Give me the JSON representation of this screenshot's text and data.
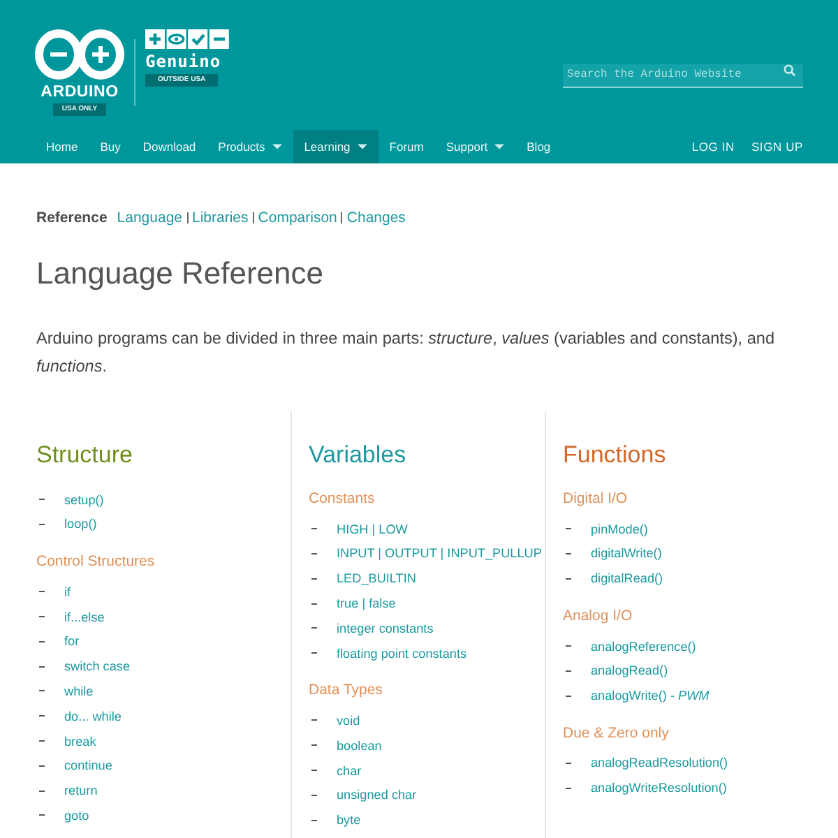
{
  "header": {
    "logo": {
      "wordmark": "ARDUINO",
      "badge": "USA ONLY"
    },
    "genuino": {
      "wordmark": "Genuino",
      "badge": "OUTSIDE USA"
    },
    "search": {
      "placeholder": "Search the Arduino Website"
    }
  },
  "nav": {
    "items": [
      {
        "label": "Home",
        "selected": false,
        "has_menu": false
      },
      {
        "label": "Buy",
        "selected": false,
        "has_menu": false
      },
      {
        "label": "Download",
        "selected": false,
        "has_menu": false
      },
      {
        "label": "Products",
        "selected": false,
        "has_menu": true
      },
      {
        "label": "Learning",
        "selected": true,
        "has_menu": true
      },
      {
        "label": "Forum",
        "selected": false,
        "has_menu": false
      },
      {
        "label": "Support",
        "selected": false,
        "has_menu": true
      },
      {
        "label": "Blog",
        "selected": false,
        "has_menu": false
      }
    ],
    "account": [
      "LOG IN",
      "SIGN UP"
    ]
  },
  "breadcrumb": {
    "current": "Reference",
    "links": [
      "Language",
      "Libraries",
      "Comparison",
      "Changes"
    ]
  },
  "title": "Language Reference",
  "intro": "Arduino programs can be divided in three main parts: *structure*, *values* (variables and constants), and *functions*.",
  "columns": [
    {
      "title": "Structure",
      "color": "#6f8f1f",
      "groups": [
        {
          "items": [
            "setup()",
            "loop()"
          ]
        },
        {
          "heading": "Control Structures",
          "items": [
            "if",
            "if...else",
            "for",
            "switch case",
            "while",
            "do... while",
            "break",
            "continue",
            "return",
            "goto"
          ]
        }
      ]
    },
    {
      "title": "Variables",
      "color": "#1e9aa0",
      "groups": [
        {
          "heading": "Constants",
          "items": [
            "HIGH | LOW",
            "INPUT | OUTPUT | INPUT_PULLUP",
            "LED_BUILTIN",
            "true | false",
            "integer constants",
            "floating point constants"
          ]
        },
        {
          "heading": "Data Types",
          "items": [
            "void",
            "boolean",
            "char",
            "unsigned char",
            "byte"
          ]
        }
      ]
    },
    {
      "title": "Functions",
      "color": "#d4682a",
      "groups": [
        {
          "heading": "Digital I/O",
          "items": [
            "pinMode()",
            "digitalWrite()",
            "digitalRead()"
          ]
        },
        {
          "heading": "Analog I/O",
          "items": [
            "analogReference()",
            "analogRead()",
            "analogWrite() - *PWM*"
          ]
        },
        {
          "heading": "Due & Zero only",
          "items": [
            "analogReadResolution()",
            "analogWriteResolution()"
          ]
        }
      ]
    }
  ]
}
